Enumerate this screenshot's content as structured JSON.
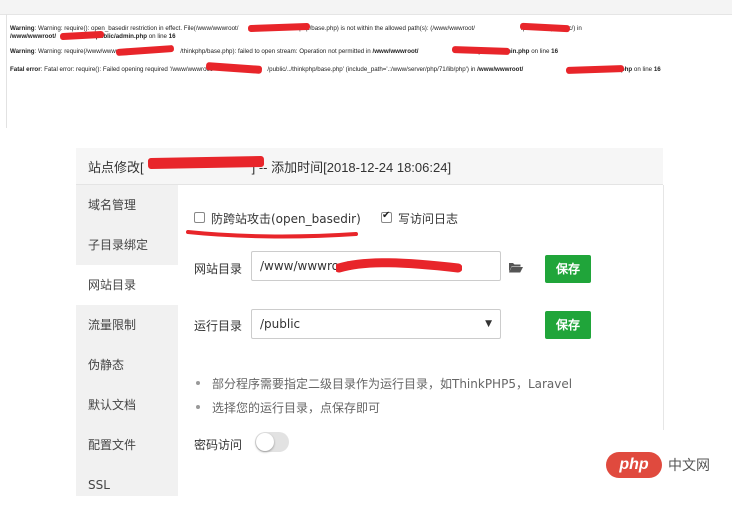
{
  "errors": {
    "line1_a": "Warning: require(): open_basedir restriction in effect. File(/www/wwwroot/",
    "line1_b": "/thinkphp/base.php) is not within the allowed path(s): (/www/wwwroot/",
    "line1_c": "/public/:/tmp/:/proc/) in",
    "line1_d": "/www/wwwroot/",
    "line1_e": "/public/admin.php",
    "line1_f": " on line ",
    "line1_g": "16",
    "line2_a": "Warning: require(/www/wwwroot/",
    "line2_b": "/thinkphp/base.php): failed to open stream: Operation not permitted in ",
    "line2_c": "/www/wwwroot/",
    "line2_d": "/public/admin.php",
    "line2_e": " on line ",
    "line2_f": "16",
    "line3_a": "Fatal error: require(): Failed opening required '/www/wwwroot/",
    "line3_b": "/public/../thinkphp/base.php' (include_path='.:/www/server/php/71/lib/php') in ",
    "line3_c": "/www/wwwroot/",
    "line3_d": "/public/admin.php",
    "line3_e": " on line ",
    "line3_f": "16"
  },
  "panel": {
    "title_prefix": "站点修改[",
    "title_suffix": "] -- 添加时间[2018-12-24 18:06:24]"
  },
  "sidebar": {
    "items": [
      {
        "label": "域名管理"
      },
      {
        "label": "子目录绑定"
      },
      {
        "label": "网站目录"
      },
      {
        "label": "流量限制"
      },
      {
        "label": "伪静态"
      },
      {
        "label": "默认文档"
      },
      {
        "label": "配置文件"
      },
      {
        "label": "SSL"
      }
    ]
  },
  "options": {
    "anti_xss_label": "防跨站攻击(open_basedir)",
    "anti_xss_checked": false,
    "access_log_label": "写访问日志",
    "access_log_checked": true
  },
  "site_dir": {
    "label": "网站目录",
    "value": "/www/wwwroot",
    "save_label": "保存",
    "folder_icon": "folder-open-icon"
  },
  "run_dir": {
    "label": "运行目录",
    "value": "/public",
    "save_label": "保存"
  },
  "tips": [
    "部分程序需要指定二级目录作为运行目录，如ThinkPHP5，Laravel",
    "选择您的运行目录，点保存即可"
  ],
  "password_access": {
    "label": "密码访问",
    "enabled": false
  },
  "watermark": {
    "logo": "php",
    "text": "中文网"
  },
  "colors": {
    "accent_green": "#20a53a",
    "redaction_red": "#e8252a"
  }
}
